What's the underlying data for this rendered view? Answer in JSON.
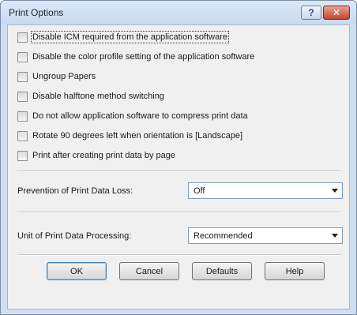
{
  "window": {
    "title": "Print Options",
    "help_button": "?",
    "close_button": "✕"
  },
  "options": [
    {
      "label": "Disable ICM required from the application software",
      "checked": false
    },
    {
      "label": "Disable the color profile setting of the application software",
      "checked": false
    },
    {
      "label": "Ungroup Papers",
      "checked": false
    },
    {
      "label": "Disable halftone method switching",
      "checked": false
    },
    {
      "label": "Do not allow application software to compress print data",
      "checked": false
    },
    {
      "label": "Rotate 90 degrees left when orientation is [Landscape]",
      "checked": false
    },
    {
      "label": "Print after creating print data by page",
      "checked": false
    }
  ],
  "prevention": {
    "label": "Prevention of Print Data Loss:",
    "value": "Off"
  },
  "unit": {
    "label": "Unit of Print Data Processing:",
    "value": "Recommended"
  },
  "buttons": {
    "ok": "OK",
    "cancel": "Cancel",
    "defaults": "Defaults",
    "help": "Help"
  }
}
